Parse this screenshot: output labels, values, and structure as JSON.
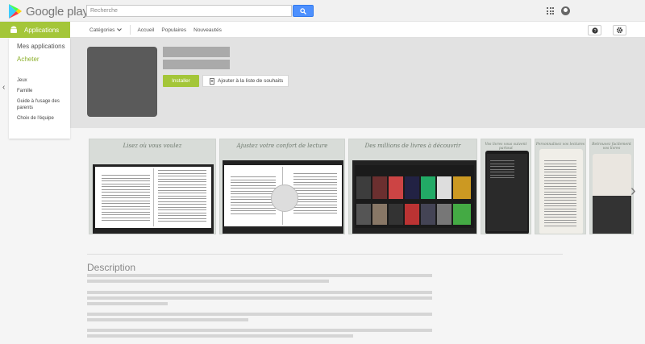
{
  "header": {
    "logo_text": "Google play",
    "search_placeholder": "Recherche"
  },
  "nav": {
    "apps_tab": "Applications",
    "categories": "Catégories",
    "links": [
      "Accueil",
      "Populaires",
      "Nouveautés"
    ]
  },
  "sidebar": {
    "primary": [
      "Mes applications",
      "Acheter"
    ],
    "secondary": [
      "Jeux",
      "Famille",
      "Guide à l'usage des parents",
      "Choix de l'équipe"
    ]
  },
  "app": {
    "install_label": "Installer",
    "wishlist_label": "Ajouter à la liste de souhaits"
  },
  "screenshots": {
    "captions": [
      "Lisez où vous voulez",
      "Ajustez votre confort de lecture",
      "Des millions de livres à découvrir",
      "Vos livres vous suivent partout",
      "Personnalisez vos lectures",
      "Retrouvez facilement vos livres"
    ]
  },
  "description": {
    "title": "Description"
  },
  "colors": {
    "accent_green": "#a4c639",
    "search_blue": "#4d90fe"
  }
}
